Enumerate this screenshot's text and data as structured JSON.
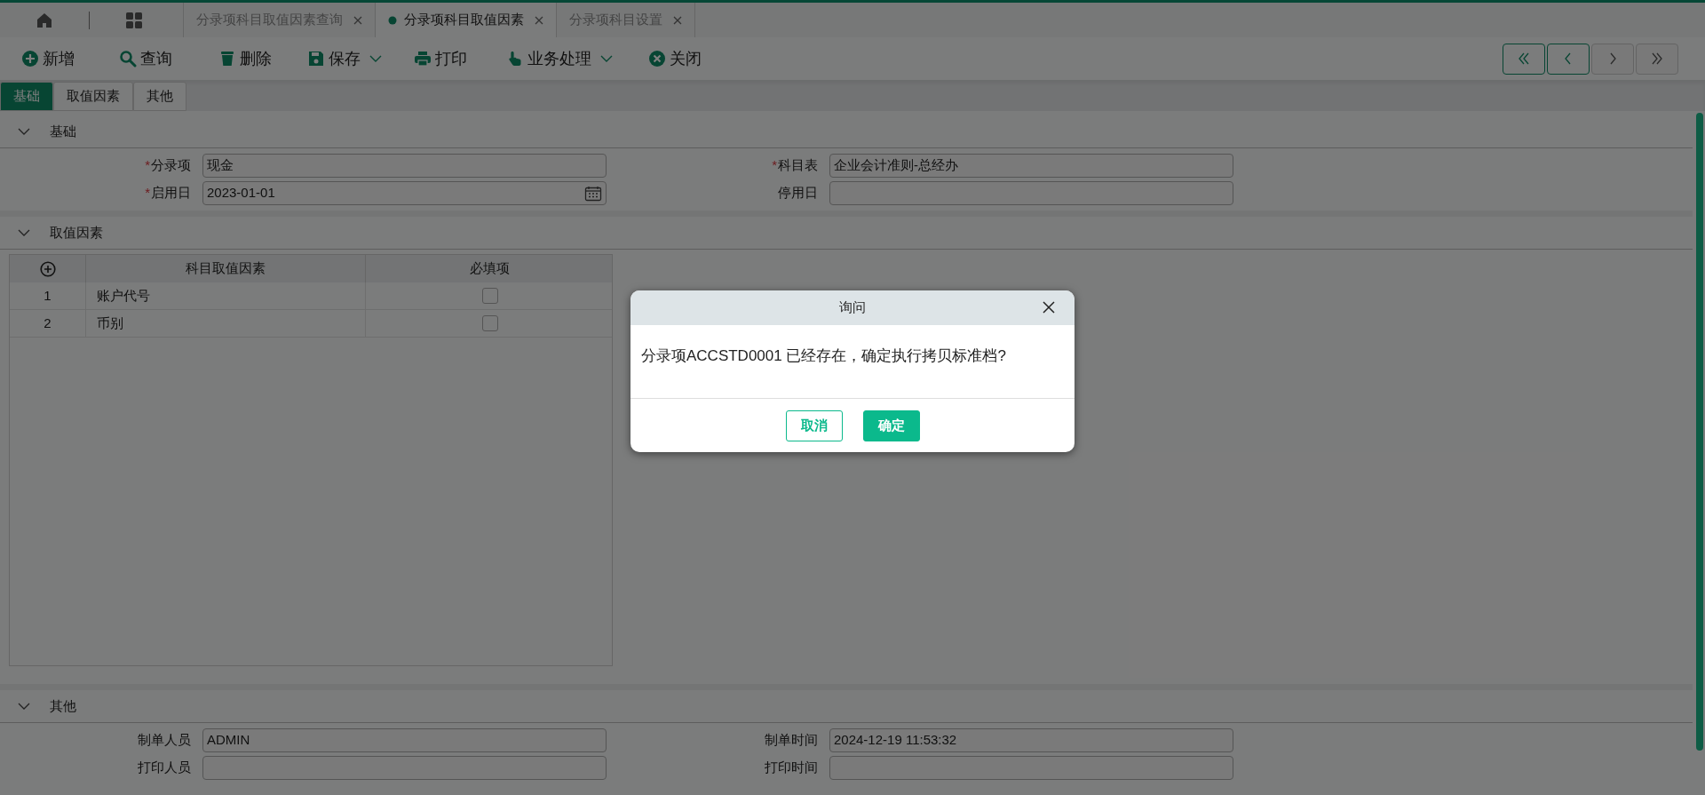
{
  "page_tabs": [
    {
      "label": "分录项科目取值因素查询",
      "selected": false
    },
    {
      "label": "分录项科目取值因素",
      "selected": true
    },
    {
      "label": "分录项科目设置",
      "selected": false
    }
  ],
  "toolbar": [
    {
      "label": "新增",
      "kind": "plus",
      "dropdown": false
    },
    {
      "label": "查询",
      "kind": "search",
      "dropdown": false
    },
    {
      "label": "删除",
      "kind": "trash",
      "dropdown": false
    },
    {
      "label": "保存",
      "kind": "save",
      "dropdown": true
    },
    {
      "label": "打印",
      "kind": "print",
      "dropdown": false
    },
    {
      "label": "业务处理",
      "kind": "hand",
      "dropdown": true
    },
    {
      "label": "关闭",
      "kind": "close",
      "dropdown": false
    }
  ],
  "record_nav": [
    {
      "kind": "first",
      "disabled": false
    },
    {
      "kind": "prev",
      "disabled": false
    },
    {
      "kind": "next",
      "disabled": true
    },
    {
      "kind": "last",
      "disabled": true
    }
  ],
  "form_tabs": [
    {
      "label": "基础",
      "selected": true
    },
    {
      "label": "取值因素",
      "selected": false
    },
    {
      "label": "其他",
      "selected": false
    }
  ],
  "basic_section": {
    "title": "基础",
    "fields": [
      {
        "label": "分录项",
        "required_mark": "*",
        "value": "现金",
        "kind": "text"
      },
      {
        "label": "科目表",
        "required_mark": "*",
        "value": "企业会计准则-总经办",
        "kind": "text"
      },
      {
        "label": "启用日",
        "required_mark": "*",
        "value": "2023-01-01",
        "kind": "date"
      },
      {
        "label": "停用日",
        "kind": "text"
      }
    ]
  },
  "factors_section": {
    "title": "取值因素",
    "table": {
      "columns": [
        "科目取值因素",
        "必填项"
      ],
      "rows": [
        {
          "index": "1",
          "factor": "账户代号",
          "required": false
        },
        {
          "index": "2",
          "factor": "币别",
          "required": false
        }
      ]
    }
  },
  "other_section": {
    "title": "其他",
    "fields": [
      {
        "label": "制单人员",
        "value": "ADMIN",
        "kind": "text"
      },
      {
        "label": "制单时间",
        "value": "2024-12-19 11:53:32",
        "kind": "text"
      },
      {
        "label": "打印人员",
        "kind": "text"
      },
      {
        "label": "打印时间",
        "kind": "text"
      }
    ]
  },
  "dialog": {
    "title": "询问",
    "message": "分录项ACCSTD0001 已经存在，确定执行拷贝标准档?",
    "buttons": [
      {
        "label": "取消",
        "kind": "secondary"
      },
      {
        "label": "确定",
        "kind": "primary"
      }
    ]
  }
}
